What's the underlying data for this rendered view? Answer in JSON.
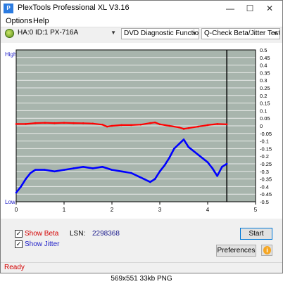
{
  "window": {
    "title": "PlexTools Professional XL V3.16",
    "app_icon_text": "P"
  },
  "menu": {
    "options": "Options",
    "help": "Help"
  },
  "toolbar": {
    "drive": "HA:0 ID:1  PX-716A",
    "function": "DVD Diagnostic Functions",
    "test": "Q-Check Beta/Jitter Test"
  },
  "chart_data": {
    "type": "line",
    "left_axis": {
      "top_label": "High",
      "bottom_label": "Low"
    },
    "x_ticks": [
      "0",
      "1",
      "2",
      "3",
      "4",
      "5"
    ],
    "xlim": [
      0,
      5
    ],
    "y_right_ticks": [
      "0.5",
      "0.45",
      "0.4",
      "0.35",
      "0.3",
      "0.25",
      "0.2",
      "0.15",
      "0.1",
      "0.05",
      "0",
      "-0.05",
      "-0.1",
      "-0.15",
      "-0.2",
      "-0.25",
      "-0.3",
      "-0.35",
      "-0.4",
      "-0.45",
      "-0.5"
    ],
    "ylim": [
      -0.5,
      0.5
    ],
    "end_marker_x": 4.4,
    "grid": true,
    "colors": {
      "beta": "#ff0000",
      "jitter": "#0000ff",
      "plot_bg": "#a8b5ad",
      "grid": "#ffffff"
    },
    "series": [
      {
        "name": "Beta",
        "x": [
          0,
          0.2,
          0.4,
          0.6,
          0.8,
          1.0,
          1.2,
          1.4,
          1.6,
          1.8,
          1.9,
          2.0,
          2.2,
          2.4,
          2.6,
          2.8,
          2.9,
          3.0,
          3.2,
          3.4,
          3.5,
          3.6,
          3.8,
          4.0,
          4.2,
          4.4
        ],
        "y": [
          0.012,
          0.012,
          0.018,
          0.02,
          0.018,
          0.02,
          0.018,
          0.017,
          0.015,
          0.008,
          -0.005,
          0.0,
          0.005,
          0.005,
          0.008,
          0.018,
          0.022,
          0.01,
          0.0,
          -0.01,
          -0.02,
          -0.015,
          -0.005,
          0.005,
          0.012,
          0.01
        ]
      },
      {
        "name": "Jitter",
        "x": [
          0,
          0.1,
          0.2,
          0.3,
          0.4,
          0.6,
          0.8,
          1.0,
          1.2,
          1.4,
          1.6,
          1.8,
          2.0,
          2.2,
          2.4,
          2.6,
          2.8,
          2.9,
          3.0,
          3.1,
          3.2,
          3.3,
          3.4,
          3.5,
          3.6,
          3.8,
          4.0,
          4.1,
          4.2,
          4.3,
          4.4
        ],
        "y": [
          -0.44,
          -0.4,
          -0.35,
          -0.31,
          -0.29,
          -0.29,
          -0.3,
          -0.29,
          -0.28,
          -0.27,
          -0.28,
          -0.27,
          -0.29,
          -0.3,
          -0.31,
          -0.34,
          -0.37,
          -0.35,
          -0.3,
          -0.26,
          -0.21,
          -0.15,
          -0.12,
          -0.09,
          -0.14,
          -0.19,
          -0.24,
          -0.28,
          -0.33,
          -0.27,
          -0.25
        ]
      }
    ]
  },
  "footer": {
    "show_beta": "Show Beta",
    "show_jitter": "Show Jitter",
    "show_beta_checked": true,
    "show_jitter_checked": true,
    "lsn_label": "LSN:",
    "lsn_value": "2298368",
    "start_button": "Start",
    "preferences_button": "Preferences"
  },
  "status": {
    "text": "Ready"
  },
  "caption": "569x551  33kb  PNG"
}
